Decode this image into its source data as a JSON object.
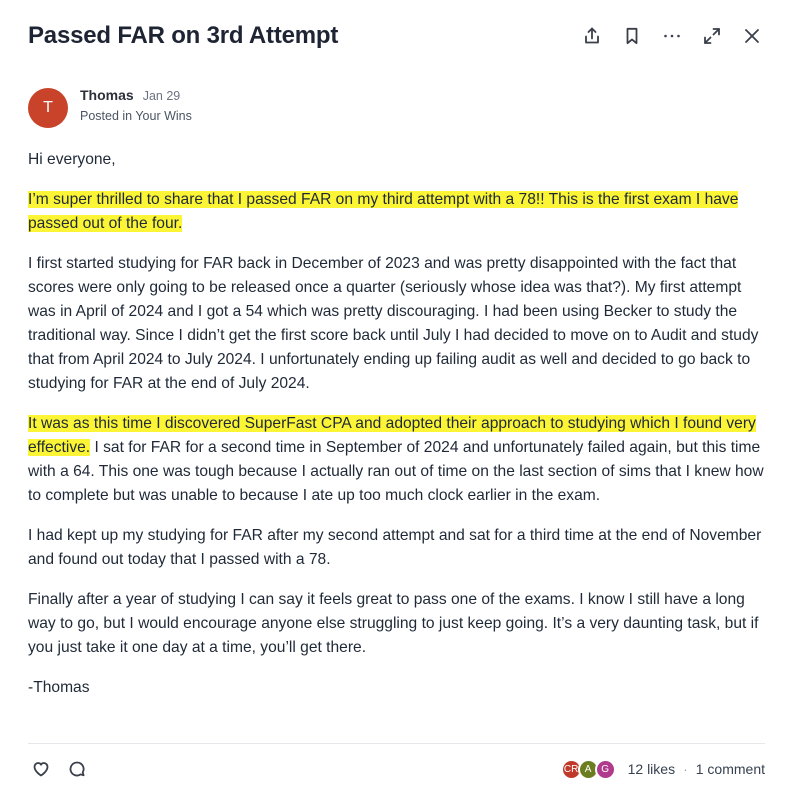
{
  "post": {
    "title": "Passed FAR on 3rd Attempt",
    "author": {
      "initial": "T",
      "name": "Thomas",
      "date": "Jan 29",
      "posted_in": "Posted in Your Wins",
      "avatar_color": "#c9432b"
    },
    "greeting": "Hi everyone,",
    "p1_highlight": "I’m super thrilled to share that I passed FAR on my third attempt with a 78!! This is the first exam I have passed out of the four.",
    "p2": " I first started studying for FAR back in December of 2023 and was pretty disappointed with the fact that scores were only going to be released once a quarter (seriously whose idea was that?). My first attempt was in April of 2024 and I got a 54 which was pretty discouraging. I had been using Becker to study the traditional way. Since I didn’t get the first score back until July I had decided to move on to Audit and study that from April 2024 to July 2024. I unfortunately ending up failing audit as well and decided to go back to studying for FAR at the end of July 2024.",
    "p3_highlight": "It was as this time I discovered SuperFast CPA and adopted their approach to studying which I found very effective.",
    "p3_rest": " I sat for FAR for a second time in September of 2024 and unfortunately failed again, but this time with a 64. This one was tough because I actually ran out of time on the last section of sims that I knew how to complete but was unable to because I ate up too much clock earlier in the exam.",
    "p4": "I had kept up my studying for FAR after my second attempt and sat for a third time at the end of November and found out today that I passed with a 78.",
    "p5": "Finally after a year of studying I can say it feels great to pass one of the exams. I know I still have a long way to go, but I would encourage anyone else struggling to just keep going. It’s a very daunting task, but if you just take it one day at a time, you’ll get there.",
    "signature": "-Thomas"
  },
  "footer": {
    "likers": [
      {
        "initials": "CR",
        "color": "#c0392b"
      },
      {
        "initials": "A",
        "color": "#6b7d1e"
      },
      {
        "initials": "G",
        "color": "#b03a8c"
      }
    ],
    "likes": "12 likes",
    "separator": "·",
    "comments": "1 comment"
  },
  "icons": [
    "share-icon",
    "bookmark-icon",
    "more-icon",
    "expand-icon",
    "close-icon",
    "heart-icon",
    "comment-icon"
  ],
  "colors": {
    "highlight": "#fbf535",
    "title": "#1e2433"
  }
}
